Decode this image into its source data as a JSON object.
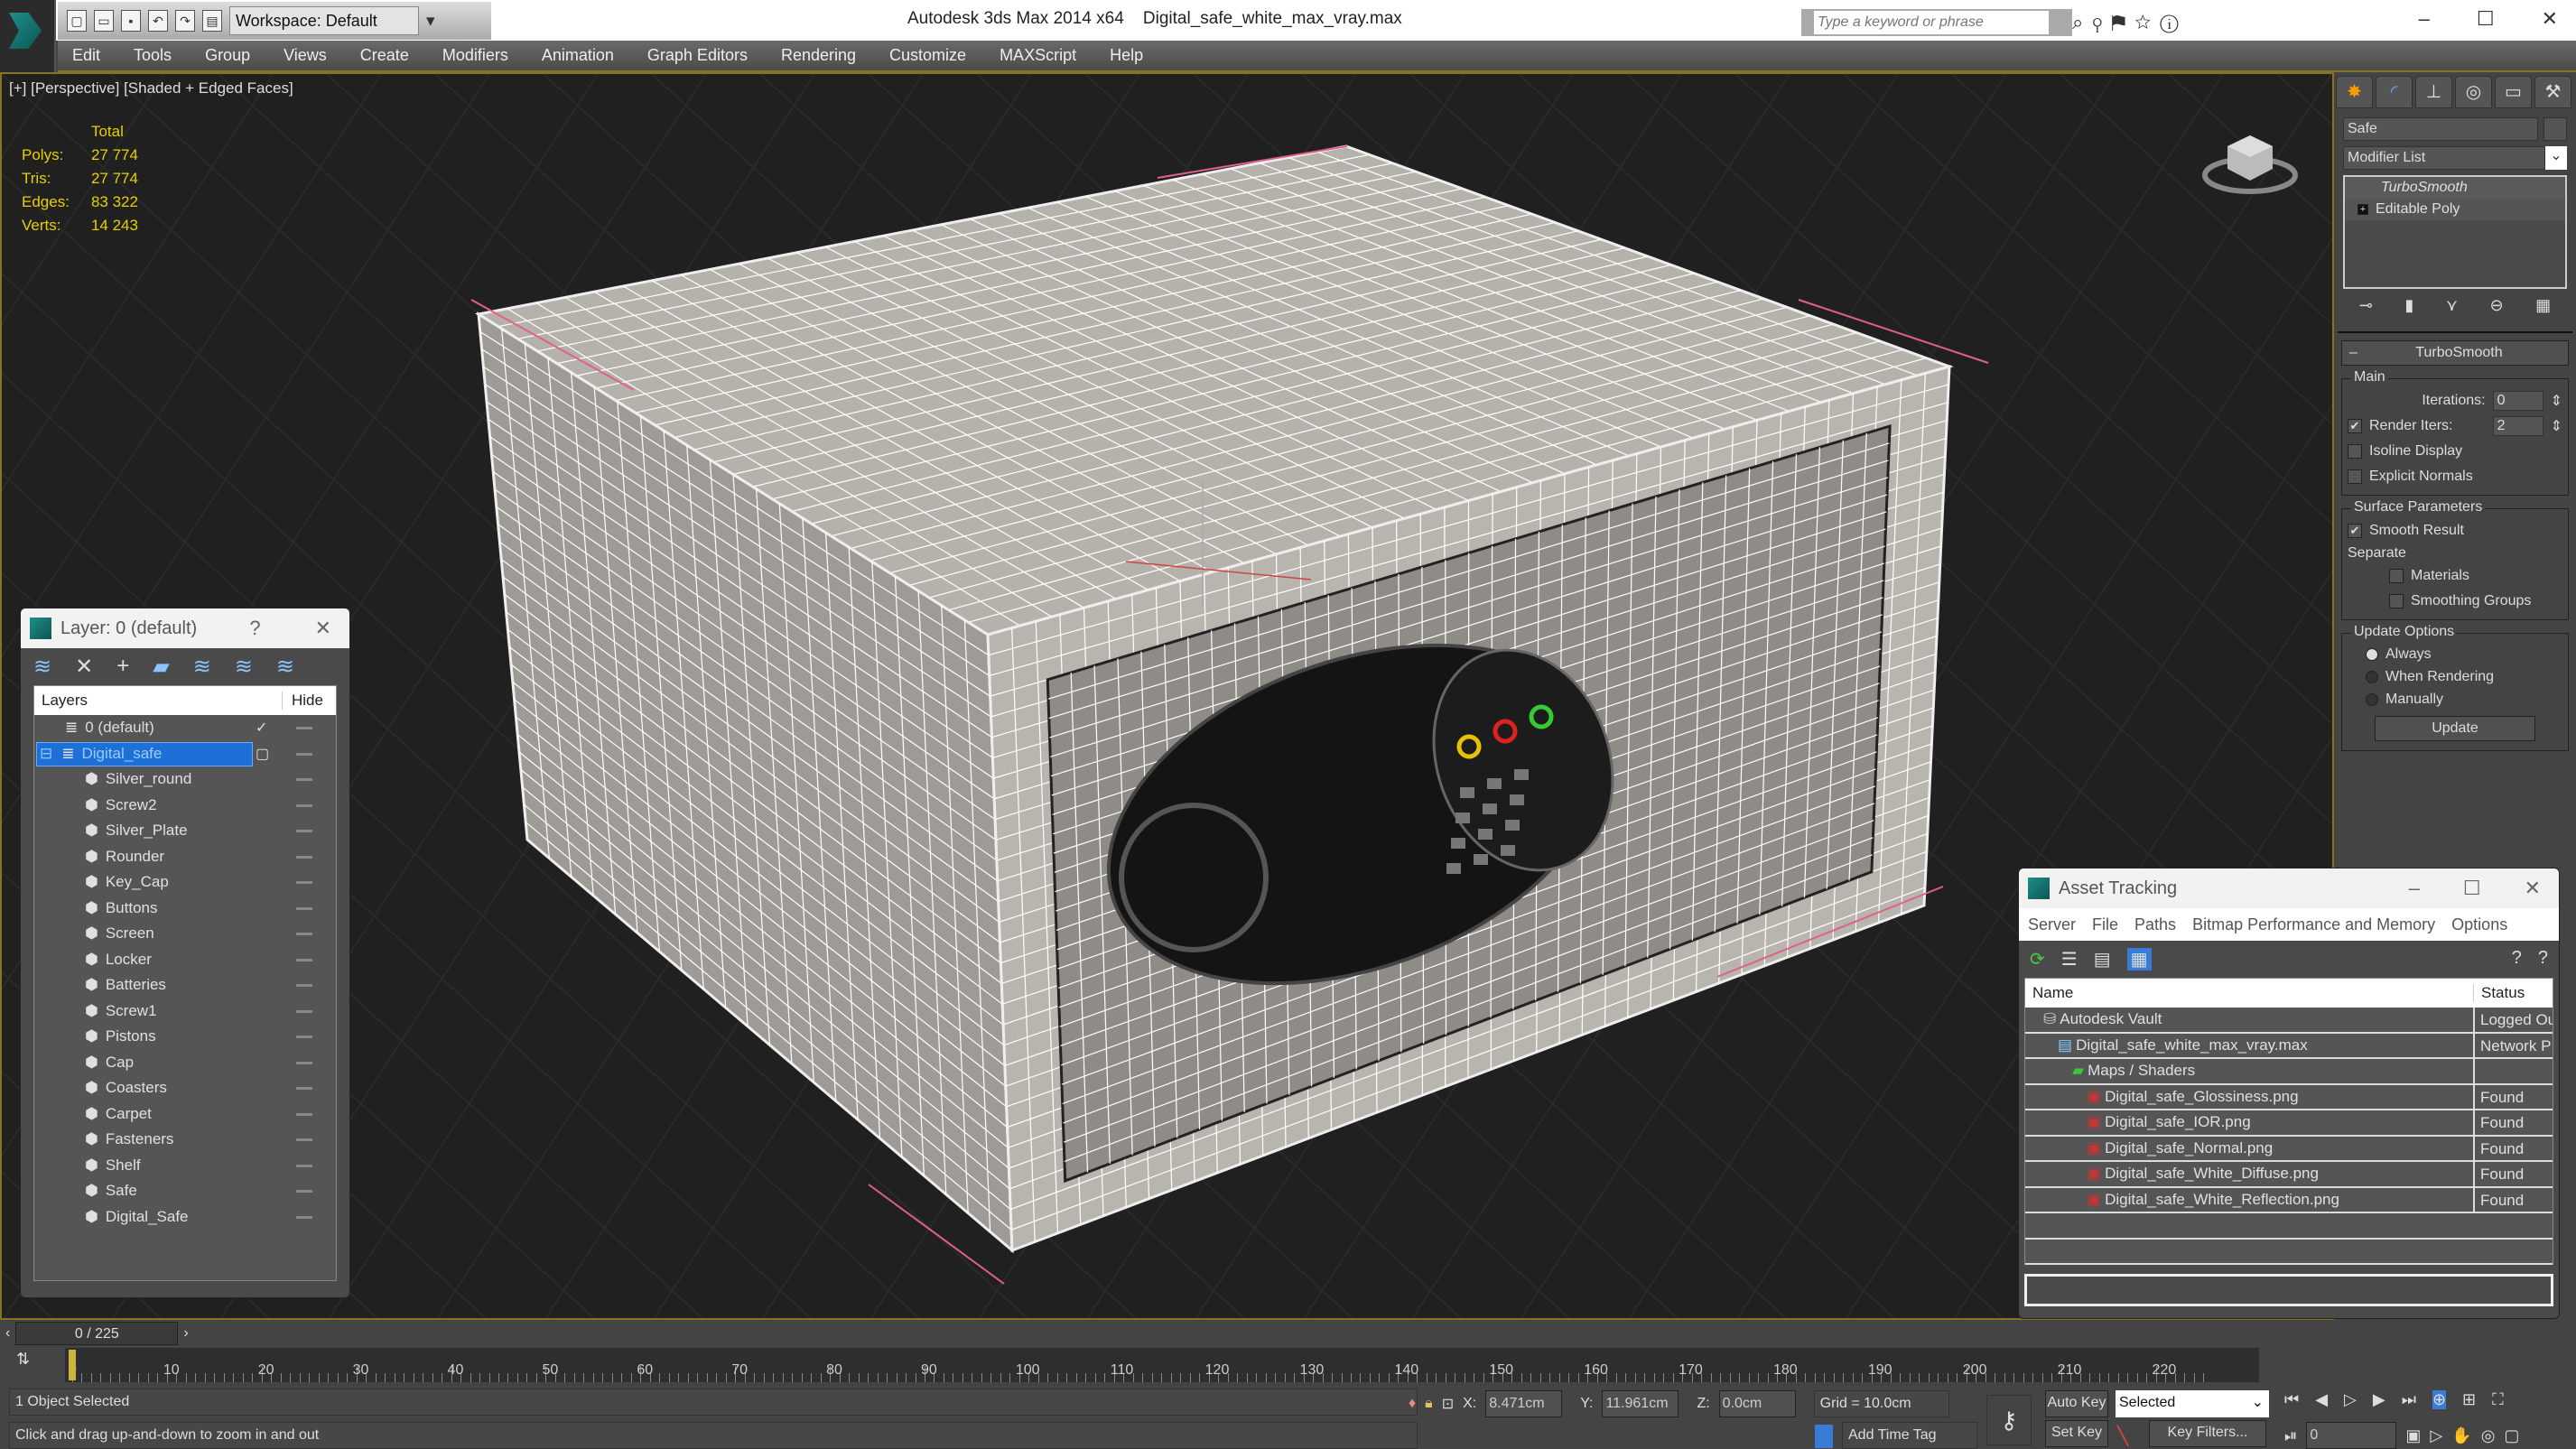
{
  "app": {
    "title": "Autodesk 3ds Max  2014 x64",
    "file": "Digital_safe_white_max_vray.max",
    "workspace": "Workspace: Default",
    "search_placeholder": "Type a keyword or phrase",
    "icons": [
      "binoculars-icon",
      "key-icon",
      "signin-icon",
      "star-icon",
      "help-icon"
    ]
  },
  "menu": [
    "Edit",
    "Tools",
    "Group",
    "Views",
    "Create",
    "Modifiers",
    "Animation",
    "Graph Editors",
    "Rendering",
    "Customize",
    "MAXScript",
    "Help"
  ],
  "viewport": {
    "label": "[+] [Perspective] [Shaded + Edged Faces]",
    "stats": {
      "header": "Total",
      "rows": [
        {
          "k": "Polys:",
          "v": "27 774"
        },
        {
          "k": "Tris:",
          "v": "27 774"
        },
        {
          "k": "Edges:",
          "v": "83 322"
        },
        {
          "k": "Verts:",
          "v": "14 243"
        }
      ]
    },
    "stats_color": "#e6d000",
    "model_color": "#b8b4ae"
  },
  "command_panel": {
    "tabs": [
      "create-icon",
      "modify-icon",
      "hierarchy-icon",
      "motion-icon",
      "display-icon",
      "utilities-icon"
    ],
    "object_name": "Safe",
    "modifier_list": "Modifier List",
    "stack": [
      "TurboSmooth",
      "Editable Poly"
    ],
    "rollout": "TurboSmooth",
    "main": {
      "title": "Main",
      "iterations_label": "Iterations:",
      "iterations": "0",
      "render_iters_label": "Render Iters:",
      "render_iters": "2",
      "render_iters_checked": true,
      "isoline": "Isoline Display",
      "explicit": "Explicit Normals"
    },
    "surface": {
      "title": "Surface Parameters",
      "smooth": "Smooth Result",
      "separate": "Separate",
      "materials": "Materials",
      "smoothing": "Smoothing Groups"
    },
    "update": {
      "title": "Update Options",
      "options": [
        "Always",
        "When Rendering",
        "Manually"
      ],
      "selected": "Always",
      "button": "Update"
    }
  },
  "layer_panel": {
    "title": "Layer: 0 (default)",
    "help": "?",
    "col_layers": "Layers",
    "col_hide": "Hide",
    "layers": [
      {
        "name": "0 (default)",
        "level": 0,
        "type": "layer",
        "current": true
      },
      {
        "name": "Digital_safe",
        "level": 0,
        "type": "layer",
        "selected": true
      }
    ],
    "objects": [
      "Silver_round",
      "Screw2",
      "Silver_Plate",
      "Rounder",
      "Key_Cap",
      "Buttons",
      "Screen",
      "Locker",
      "Batteries",
      "Screw1",
      "Pistons",
      "Cap",
      "Coasters",
      "Carpet",
      "Fasteners",
      "Shelf",
      "Safe",
      "Digital_Safe"
    ]
  },
  "asset_tracking": {
    "title": "Asset Tracking",
    "menu": [
      "Server",
      "File",
      "Paths",
      "Bitmap Performance and Memory",
      "Options"
    ],
    "col_name": "Name",
    "col_status": "Status",
    "rows": [
      {
        "name": "Autodesk Vault",
        "status": "Logged Ou",
        "level": 1,
        "icon": "vault-icon"
      },
      {
        "name": "Digital_safe_white_max_vray.max",
        "status": "Network P",
        "level": 2,
        "icon": "max-file-icon"
      },
      {
        "name": "Maps / Shaders",
        "status": "",
        "level": 3,
        "icon": "maps-icon"
      },
      {
        "name": "Digital_safe_Glossiness.png",
        "status": "Found",
        "level": 4,
        "icon": "png-icon"
      },
      {
        "name": "Digital_safe_IOR.png",
        "status": "Found",
        "level": 4,
        "icon": "png-icon"
      },
      {
        "name": "Digital_safe_Normal.png",
        "status": "Found",
        "level": 4,
        "icon": "png-icon"
      },
      {
        "name": "Digital_safe_White_Diffuse.png",
        "status": "Found",
        "level": 4,
        "icon": "png-icon"
      },
      {
        "name": "Digital_safe_White_Reflection.png",
        "status": "Found",
        "level": 4,
        "icon": "png-icon"
      }
    ]
  },
  "timeline": {
    "frame": "0 / 225",
    "current": 0,
    "total": 225,
    "ticks": [
      "0",
      "10",
      "20",
      "30",
      "40",
      "50",
      "60",
      "70",
      "80",
      "90",
      "100",
      "110",
      "120",
      "130",
      "140",
      "150",
      "160",
      "170",
      "180",
      "190",
      "200",
      "210",
      "220"
    ]
  },
  "status": {
    "selection": "1 Object Selected",
    "prompt": "Click and drag up-and-down to zoom in and out",
    "x_label": "X:",
    "x": "8.471cm",
    "y_label": "Y:",
    "y": "11.961cm",
    "z_label": "Z:",
    "z": "0.0cm",
    "grid": "Grid = 10.0cm",
    "add_time_tag": "Add Time Tag",
    "auto_key": "Auto Key",
    "set_key": "Set Key",
    "key_mode": "Selected",
    "key_filters": "Key Filters...",
    "frame_field": "0"
  }
}
